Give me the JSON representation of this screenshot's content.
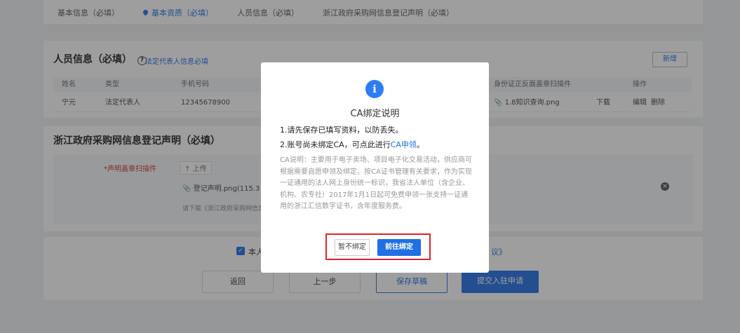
{
  "tabs": [
    {
      "label": "基本信息（必填）"
    },
    {
      "label": "基本资质（必填）"
    },
    {
      "label": "人员信息（必填）"
    },
    {
      "label": "浙江政府采购网信息登记声明（必填）"
    }
  ],
  "personnel": {
    "title": "人员信息（必填）",
    "help_icon": "?",
    "legal_link": "法定代表人信息必填",
    "add_button": "新增",
    "columns": [
      "姓名",
      "类型",
      "手机号码",
      "身份证正反面盖章扫描件",
      "操作"
    ],
    "rows": [
      {
        "name": "宁元",
        "type": "法定代表人",
        "phone": "12345678900",
        "file": "1.8知识查询.png",
        "download": "下载",
        "edit": "编辑",
        "delete": "删除"
      }
    ]
  },
  "declaration": {
    "title": "浙江政府采购网信息登记声明（必填）",
    "field_label": "*声明盖章扫描件",
    "upload_button": "上传",
    "file_name": "登记声明.png(115.3",
    "download_hint": "请下载《浙江政府采购网信息"
  },
  "agreement": {
    "prefix": "本人",
    "suffix": "议》"
  },
  "actions": {
    "back": "返回",
    "prev": "上一步",
    "save_draft": "保存草稿",
    "submit": "提交入驻申请"
  },
  "dialog": {
    "icon": "i",
    "title": "CA绑定说明",
    "line1": "1.请先保存已填写资料，以防丢失。",
    "line2_text": "2.账号尚未绑定CA，可点此进行",
    "line2_link": "CA申领",
    "line2_end": "。",
    "note": "CA说明：主要用于电子卖场、项目电子化交易活动，供应商可根据需要自愿申领及绑定。按CA证书管理有关要求，作为实现一证通用的法人网上身份统一标识，我省法人单位（含企业、机构、农专社）2017年1月1日起可免费申领一张支持一证通用的浙江汇信数字证书，含年度服务费。",
    "skip_button": "暂不绑定",
    "bind_button": "前往绑定"
  },
  "colors": {
    "accent": "#1f6fe5",
    "highlight": "#e0242b"
  }
}
